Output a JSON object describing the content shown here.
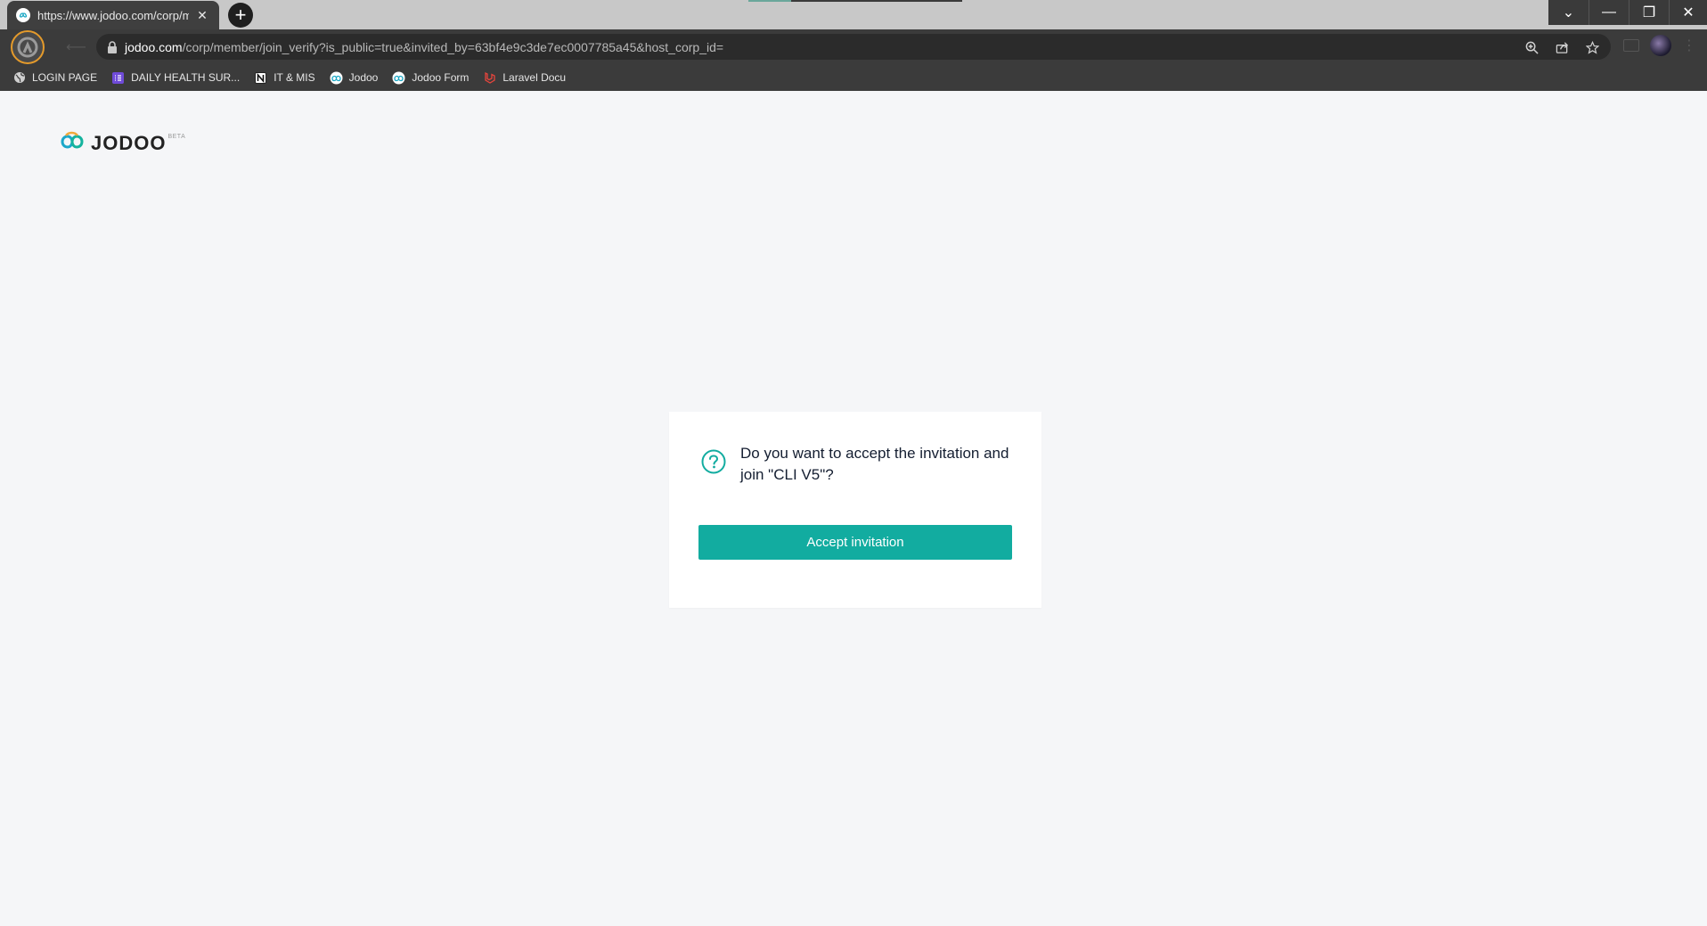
{
  "browser": {
    "tab": {
      "title": "https://www.jodoo.com/corp/me",
      "close": "✕"
    },
    "new_tab": "+",
    "window_controls": {
      "tabs_dropdown": "⌄",
      "minimize": "—",
      "restore": "❐",
      "close": "✕"
    },
    "address": {
      "host": "jodoo.com",
      "path": "/corp/member/join_verify?is_public=true&invited_by=63bf4e9c3de7ec0007785a45&host_corp_id="
    },
    "bookmarks": [
      {
        "label": "LOGIN PAGE",
        "icon": "globe-icon"
      },
      {
        "label": "DAILY HEALTH SUR...",
        "icon": "form-list-icon"
      },
      {
        "label": "IT & MIS",
        "icon": "notion-icon"
      },
      {
        "label": "Jodoo",
        "icon": "jodoo-icon"
      },
      {
        "label": "Jodoo Form",
        "icon": "jodoo-icon"
      },
      {
        "label": "Laravel Docu",
        "icon": "laravel-icon"
      }
    ]
  },
  "page": {
    "brand": {
      "name": "JODOO",
      "badge": "BETA"
    },
    "dialog": {
      "question": "Do you want to accept the invitation and join \"CLI V5\"?",
      "accept_label": "Accept invitation"
    }
  },
  "colors": {
    "accent": "#12aca0",
    "page_background": "#f5f6f8",
    "chrome_dark": "#3b3b3b"
  }
}
